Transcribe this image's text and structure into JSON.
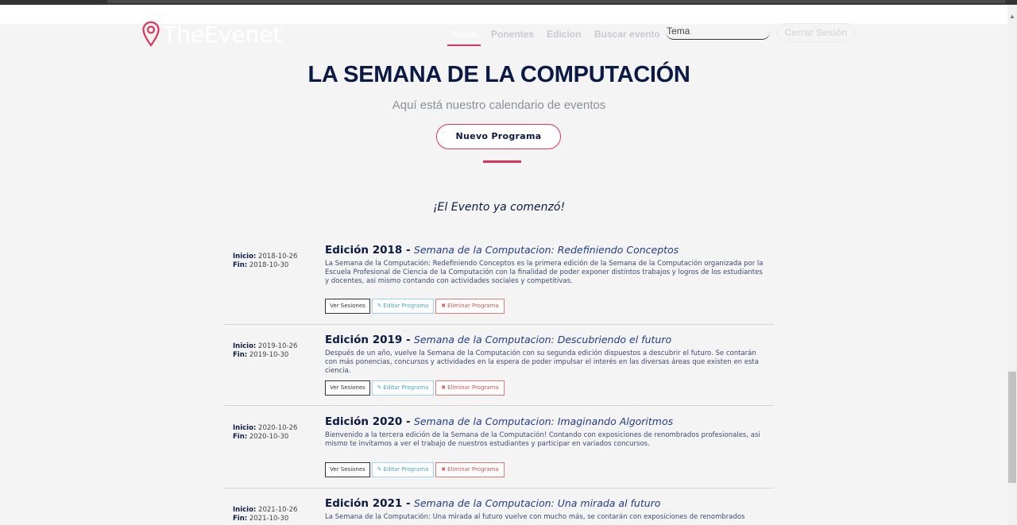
{
  "brand": {
    "name": "TheEvenet",
    "accent": "#e0325a",
    "navy": "#0b1a45"
  },
  "nav": {
    "links": [
      {
        "label": "Inicio",
        "active": true
      },
      {
        "label": "Ponentes",
        "active": false
      },
      {
        "label": "Edicion",
        "active": false
      },
      {
        "label": "Buscar evento",
        "active": false
      }
    ],
    "search_placeholder": "Tema",
    "logout_label": "Cerrar Sesión"
  },
  "hero": {
    "title": "LA SEMANA DE LA COMPUTACIÓN",
    "subtitle": "Aquí está nuestro calendario de eventos",
    "new_program_label": "Nuevo Programa",
    "status_message": "¡El Evento ya comenzó!"
  },
  "labels": {
    "start": "Inicio:",
    "end": "Fin:",
    "view_sessions": "Ver Sesiones",
    "edit_program": "Editar Programa",
    "delete_program": "Eliminar Programa"
  },
  "programs": [
    {
      "edition": "Edición 2018 -",
      "name": "Semana de la Computacion: Redefiniendo Conceptos",
      "start": "2018-10-26",
      "end": "2018-10-30",
      "description": "La Semana de la Computación: Redefiniendo Conceptos es la primera edición de la Semana de la Computación organizada por la Escuela Profesional de Ciencia de la Computación con la finalidad de poder exponer distintos trabajos y logros de los estudiantes y docentes, asi mismo contando con actividades sociales y competitivas."
    },
    {
      "edition": "Edición 2019 -",
      "name": "Semana de la Computacion: Descubriendo el futuro",
      "start": "2019-10-26",
      "end": "2019-10-30",
      "description": "Después de un año, vuelve la Semana de la Computación con su segunda edición dispuestos a descubrir el futuro. Se contarán con más ponencias, concursos y actividades en la espera de poder impulsar el interés en las diversas áreas que existen en esta ciencia."
    },
    {
      "edition": "Edición 2020 -",
      "name": "Semana de la Computacion: Imaginando Algoritmos",
      "start": "2020-10-26",
      "end": "2020-10-30",
      "description": "Bienvenido a la tercera edición de la Semana de la Computación! Contando con exposiciones de renombrados profesionales, asi mismo te invitamos a ver el trabajo de nuestros estudiantes y participar en variados concursos."
    },
    {
      "edition": "Edición 2021 -",
      "name": "Semana de la Computacion: Una mirada al futuro",
      "start": "2021-10-26",
      "end": "2021-10-30",
      "description": "La Semana de la Computación: Una mirada al futuro vuelve con mucho más, se contarán con exposiciones de renombrados"
    }
  ]
}
